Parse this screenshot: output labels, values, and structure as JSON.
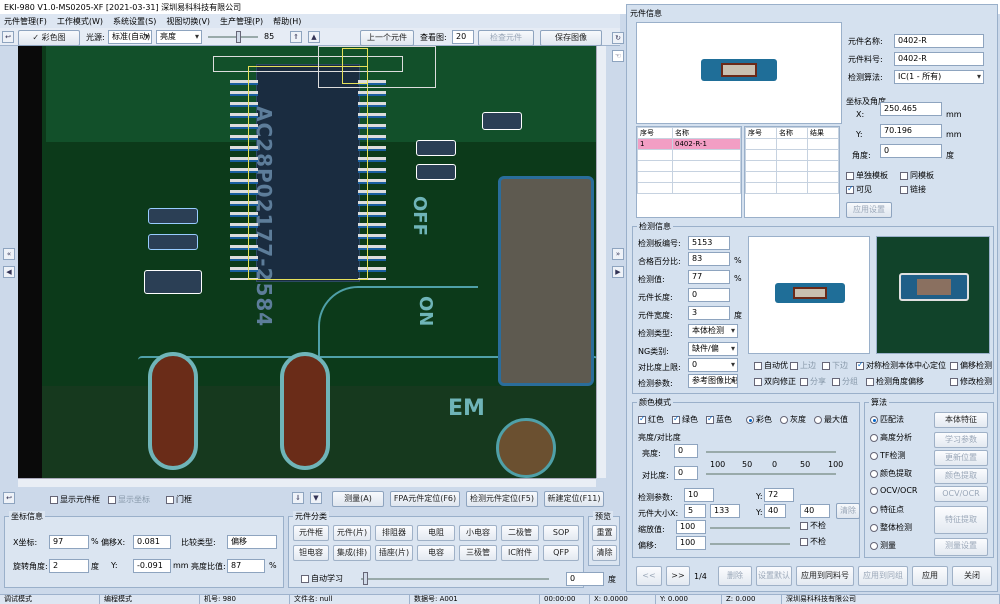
{
  "window": {
    "title": "EKI-980 V1.0-MS0205-XF [2021-03-31] 深圳易科科技有限公司"
  },
  "menu": [
    "元件管理(F)",
    "工作模式(W)",
    "系统设置(S)",
    "视图切换(V)",
    "生产管理(P)",
    "帮助(H)"
  ],
  "toolbar": {
    "camera_toggle": "✓ 彩色图",
    "view_mode": "标准(自动)",
    "light_label": "亮度",
    "brightness": "85",
    "prev_button": "上一个元件",
    "next_field_label": "查看图:",
    "next_field_value": "20",
    "last_button": "检查元件",
    "save_image_button": "保存图像"
  },
  "image_bottom": {
    "checkboxes": [
      "显示元件框",
      "显示坐标",
      "门框"
    ],
    "buttons": [
      "测量(A)",
      "FPA元件定位(F6)",
      "检测元件定位(F5)",
      "新建定位(F11)"
    ]
  },
  "board_text": {
    "chip": "AC28P02177-2584",
    "silk1": "OFF",
    "silk2": "ON",
    "silk3": "EM"
  },
  "comp_info_panel": {
    "title": "元件信息",
    "fields": [
      {
        "label": "元件名称:",
        "value": "0402-R"
      },
      {
        "label": "元件料号:",
        "value": "0402-R"
      },
      {
        "label": "检测算法:",
        "value": "IC(1 - 所有)"
      }
    ],
    "coord_title": "坐标及角度",
    "x_label": "X:",
    "x_value": "250.465",
    "x_unit": "mm",
    "y_label": "Y:",
    "y_value": "70.196",
    "y_unit": "mm",
    "angle_label": "角度:",
    "angle_value": "0",
    "angle_unit": "度",
    "list_headers_left": [
      "序号",
      "名称"
    ],
    "list_headers_right": [
      "序号",
      "名称",
      "结果"
    ],
    "list_left_row": [
      "1",
      "0402-R-1"
    ],
    "options": [
      "单独模板",
      "同模板",
      "可见",
      "链接"
    ],
    "apply_button": "应用设置"
  },
  "detect_panel": {
    "title": "检测信息",
    "rows": [
      {
        "label": "检测板编号:",
        "value": "5153"
      },
      {
        "label": "合格百分比:",
        "value": "83",
        "unit": "%"
      },
      {
        "label": "检测值:",
        "value": "77",
        "unit": "%"
      },
      {
        "label": "元件长度:",
        "value": "0"
      },
      {
        "label": "元件宽度:",
        "value": "3",
        "unit": "度"
      },
      {
        "label": "检测类型:",
        "value": "本体检测"
      },
      {
        "label": "NG类别:",
        "value": "缺件/偏"
      }
    ],
    "filter_label": "对比度上限:",
    "filter_value": "0",
    "sync_label": "检测参数:",
    "sync_value": "参考图像比较",
    "checks1": [
      "自动优",
      "上边",
      "下边",
      "对称检测本体中心定位",
      "偏移检测"
    ],
    "checks2": [
      "双向修正",
      "分享",
      "分组",
      "检测角度偏移",
      "修改检测"
    ]
  },
  "color_panel": {
    "title": "颜色模式",
    "channels": [
      "红色",
      "绿色",
      "蓝色"
    ],
    "modes": [
      "彩色",
      "灰度",
      "最大值"
    ],
    "contrast_title": "亮度/对比度",
    "bright_label": "亮度:",
    "bright_value": "0",
    "contrast_label": "对比度:",
    "contrast_value": "0",
    "scale": [
      "100",
      "50",
      "0",
      "50",
      "100"
    ],
    "extra_rows": [
      {
        "label": "检测参数:",
        "value": "10",
        "label2": "Y:",
        "value2": "72"
      },
      {
        "label": "元件大小X:",
        "value": "5",
        "v2": "133",
        "label2": "Y:",
        "value3": "40",
        "v4": "40"
      },
      {
        "label": "缩放值:",
        "value": "100",
        "tail": "不检"
      },
      {
        "label": "偏移:",
        "value": "100",
        "tail": "不检"
      }
    ],
    "reset_button": "清除"
  },
  "algo_panel": {
    "title": "算法",
    "options": [
      "匹配法",
      "高度分析",
      "TF检测",
      "颜色提取",
      "OCV/OCR",
      "特征点",
      "整体检测",
      "测量"
    ],
    "buttons": [
      "本体特征",
      "学习参数",
      "更新位置",
      "颜色提取",
      "OCV/OCR",
      "特征提取",
      "测量设置"
    ]
  },
  "bottom_right_buttons": {
    "first": "<<",
    "next": ">>",
    "page": "1/4",
    "delete": "删除",
    "set_default": "设置默认",
    "apply_all": "应用到同料号",
    "apply_group": "应用到同组",
    "apply": "应用",
    "close": "关闭"
  },
  "coord_panel": {
    "title": "坐标信息",
    "rows": [
      {
        "label": "X坐标:",
        "value": "97",
        "unit": "%",
        "label2": "偏移X:",
        "value2": "0.081",
        "label3": "比较类型:",
        "value3": "偏移"
      },
      {
        "label": "旋转角度:",
        "value": "2",
        "unit": "度",
        "label2": "Y:",
        "value2": "-0.091",
        "unit2": "mm",
        "label3": "亮度比值:",
        "value3": "87",
        "unit3": "%"
      }
    ]
  },
  "comp_group_panel": {
    "title": "元件分类",
    "buttons_row1": [
      "元件框",
      "元件(片)",
      "排阻器",
      "电阻",
      "小电容",
      "二极管",
      "SOP"
    ],
    "buttons_row2": [
      "钽电容",
      "集成(排)",
      "插座(片)",
      "电容",
      "三极管",
      "IC附件",
      "QFP"
    ],
    "auto_check": "自动学习",
    "slider_value": "0",
    "slider_unit": "度"
  },
  "side_buttons": {
    "top": "重置",
    "bottom": "清除"
  },
  "status": [
    "调试模式",
    "编程模式",
    "机号: 980",
    "文件名: null",
    "数据号: A001",
    "00:00:00",
    "X: 0.0000",
    "Y: 0.000",
    "Z: 0.000",
    "深圳易科科技有限公司"
  ]
}
